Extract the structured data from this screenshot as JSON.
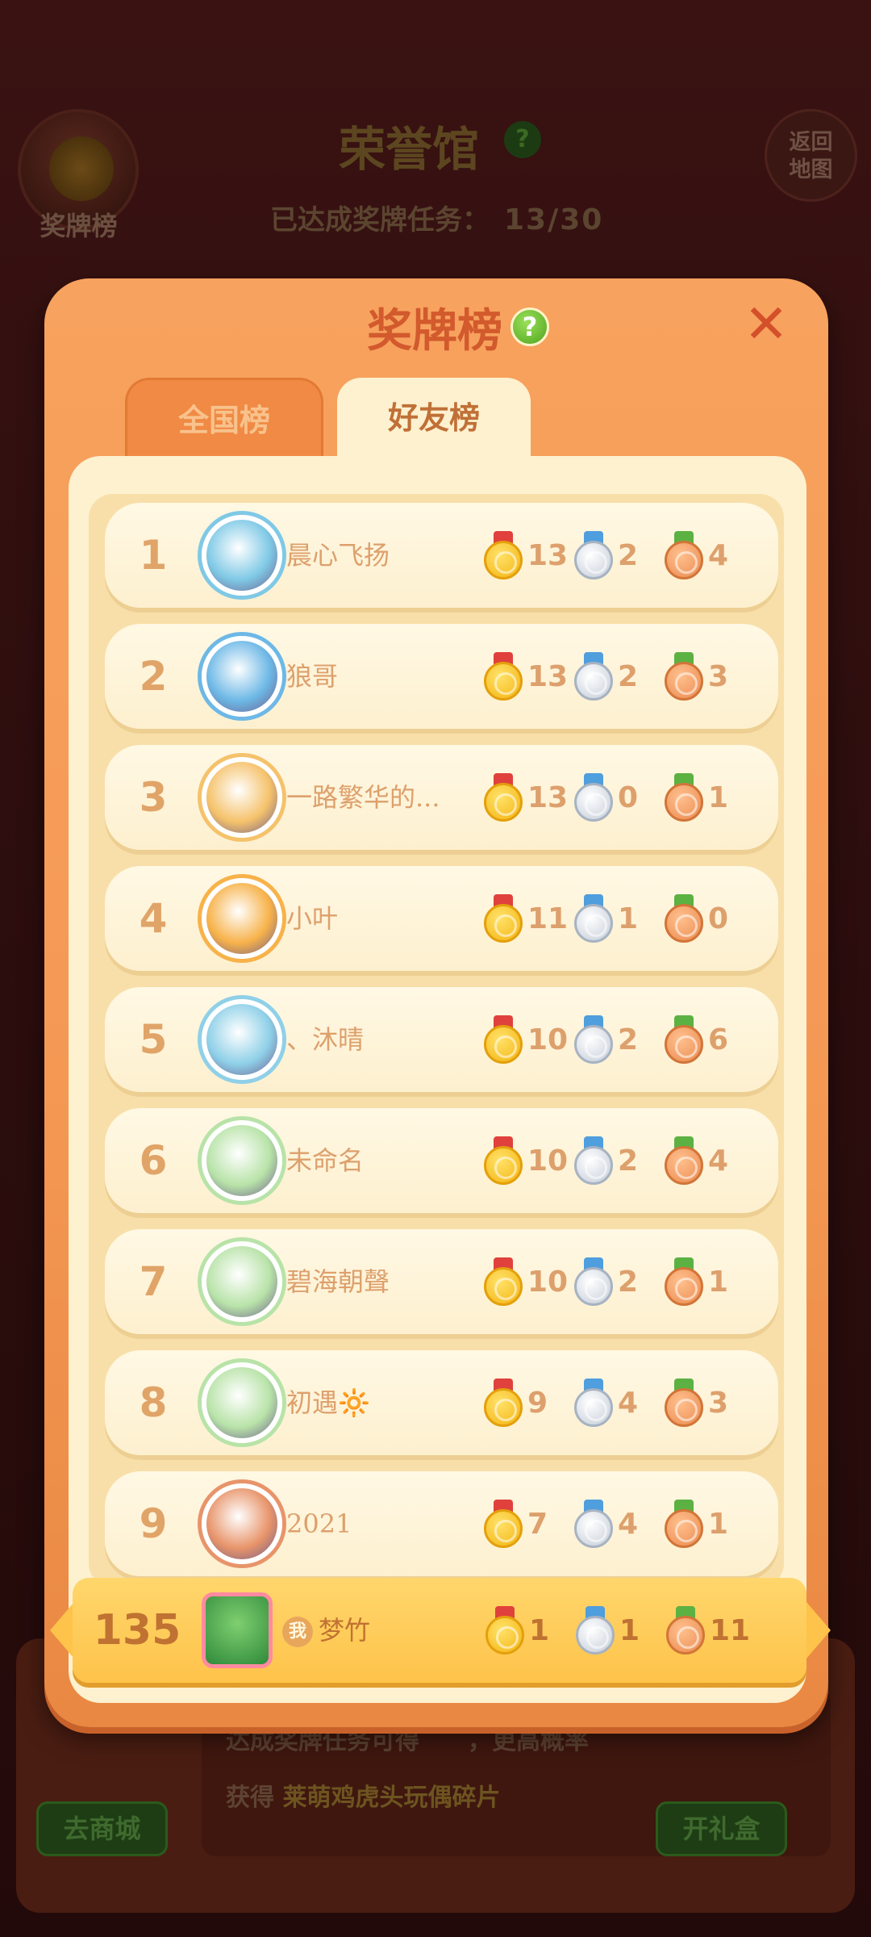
{
  "background": {
    "medal_button_label": "奖牌榜",
    "page_title": "荣誉馆",
    "help_glyph": "?",
    "return_button_label": "返回\n地图",
    "progress_label": "已达成奖牌任务：",
    "progress_value": "13/30",
    "reward_line1": "达成奖牌任务可得",
    "reward_line1_suffix": "，更高概率",
    "reward_line2_prefix": "获得",
    "reward_line2_item": "莱萌鸡虎头玩偶碎片",
    "shop_button": "去商城",
    "open_gift_button": "开礼盒"
  },
  "modal": {
    "title": "奖牌榜",
    "help_glyph": "?",
    "close_glyph": "✕",
    "tabs": [
      {
        "label": "全国榜",
        "active": false
      },
      {
        "label": "好友榜",
        "active": true
      }
    ]
  },
  "leaderboard": [
    {
      "rank": "1",
      "name": "晨心飞扬",
      "gold": "13",
      "silver": "2",
      "bronze": "4",
      "avatar_color": "#7fc9e6"
    },
    {
      "rank": "2",
      "name": "狼哥",
      "gold": "13",
      "silver": "2",
      "bronze": "3",
      "avatar_color": "#6db8e6"
    },
    {
      "rank": "3",
      "name": "一路繁华的...",
      "gold": "13",
      "silver": "0",
      "bronze": "1",
      "avatar_color": "#f5c26b"
    },
    {
      "rank": "4",
      "name": "小叶",
      "gold": "11",
      "silver": "1",
      "bronze": "0",
      "avatar_color": "#f7b24a"
    },
    {
      "rank": "5",
      "name": "、沐晴",
      "gold": "10",
      "silver": "2",
      "bronze": "6",
      "avatar_color": "#8fd0e8"
    },
    {
      "rank": "6",
      "name": "未命名",
      "gold": "10",
      "silver": "2",
      "bronze": "4",
      "avatar_color": "#b8e3a8"
    },
    {
      "rank": "7",
      "name": "碧海朝聲",
      "gold": "10",
      "silver": "2",
      "bronze": "1",
      "avatar_color": "#b8e3a8"
    },
    {
      "rank": "8",
      "name": "初遇🔆",
      "gold": "9",
      "silver": "4",
      "bronze": "3",
      "avatar_color": "#b8e3a8"
    },
    {
      "rank": "9",
      "name": "2021",
      "gold": "7",
      "silver": "4",
      "bronze": "1",
      "avatar_color": "#e8946a"
    }
  ],
  "self": {
    "rank": "135",
    "me_badge": "我",
    "name": "梦竹",
    "gold": "1",
    "silver": "1",
    "bronze": "11"
  }
}
